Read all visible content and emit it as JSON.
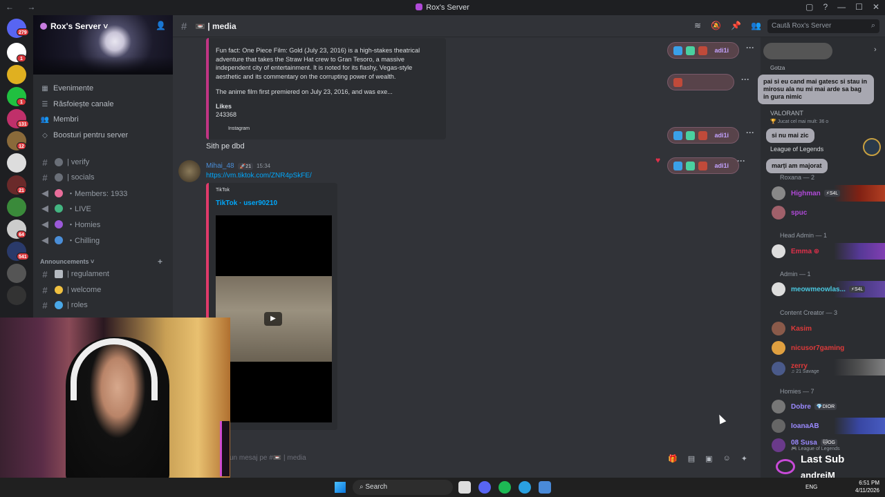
{
  "window": {
    "title": "Rox's Server",
    "nav": "← →",
    "controls": [
      "▢",
      "?",
      "—",
      "☐",
      "✕"
    ]
  },
  "guild_badges": [
    "279",
    "1",
    "1",
    "1",
    "131",
    "12",
    "21",
    "64",
    "541"
  ],
  "server": {
    "name": "Rox's Server ˅"
  },
  "menu": [
    {
      "icon": "calendar-icon",
      "label": "Evenimente"
    },
    {
      "icon": "browse-icon",
      "label": "Răsfoiește canale"
    },
    {
      "icon": "members-icon",
      "label": "Membri"
    },
    {
      "icon": "boost-icon",
      "label": "Boosturi pentru server"
    }
  ],
  "channels": [
    {
      "label": "| verify",
      "color": "#6a6f78"
    },
    {
      "label": "| socials",
      "color": "#6a6f78"
    },
    {
      "label": "・Members: 1933",
      "color": "#e86d9a"
    },
    {
      "label": "・LIVE",
      "color": "#43b581"
    },
    {
      "label": "・Homies",
      "color": "#9b59d8"
    },
    {
      "label": "・Chilling",
      "color": "#4a8ed8"
    }
  ],
  "category": "Announcements ˅",
  "announcement_channels": [
    {
      "label": "| regulament"
    },
    {
      "label": "| welcome"
    },
    {
      "label": "| roles"
    }
  ],
  "header": {
    "channel": "📼 | media",
    "search_placeholder": "Caută Rox's Server"
  },
  "embed": {
    "text": "Fun fact: One Piece Film: Gold (July 23, 2016) is a high-stakes theatrical adventure that takes the Straw Hat crew to Gran Tesoro, a massive independent city of entertainment. It is noted for its flashy, Vegas-style aesthetic and its commentary on the corrupting power of wealth.",
    "text2": "The anime film first premiered on July 23, 2016, and was exe...",
    "likes_label": "Likes",
    "likes": "243368",
    "provider": "Instagram"
  },
  "msg1": "Sith pe dbd",
  "msg2": {
    "author": "Mihai_48",
    "tag": "🚀21",
    "time": "15:34",
    "link": "https://vm.tiktok.com/ZNR4pSkFE/"
  },
  "tiktok": {
    "provider": "TikTok",
    "title": "TikTok · user90210",
    "play": "▶"
  },
  "reactions": [
    "adi1i",
    "adi1i",
    "adi1i",
    "adi1i"
  ],
  "input": {
    "placeholder": "un mesaj pe #📼 | media"
  },
  "members": {
    "cats": [
      "Roxana — 2",
      "Head Admin — 1",
      "Admin — 1",
      "Content Creator — 3",
      "Homies — 7"
    ],
    "roxana": [
      {
        "name": "Highman",
        "tag": "⚡S4L",
        "color": "#b04ad8"
      },
      {
        "name": "spuc",
        "color": "#b04ad8"
      }
    ],
    "headadmin": [
      {
        "name": "Emma ⊕",
        "color": "#e0304a"
      }
    ],
    "admin": [
      {
        "name": "meowmeowlas...",
        "tag": "⚡S4L",
        "color": "#4ac8e0"
      }
    ],
    "cc": [
      {
        "name": "Kasim",
        "color": "#e03a3a"
      },
      {
        "name": "nicusor7gaming",
        "color": "#e03a3a"
      },
      {
        "name": "zerry",
        "sub": "♫ 21 Savage",
        "color": "#e03a3a"
      }
    ],
    "homies": [
      {
        "name": "Dobre",
        "tag": "💎DIOR",
        "color": "#9b8aff"
      },
      {
        "name": "IoanaAB",
        "color": "#9b8aff"
      },
      {
        "name": "08 Susa",
        "tag": "🐱OG",
        "sub": "🎮 League of Legends",
        "color": "#9b8aff"
      }
    ]
  },
  "activity": {
    "game1": "VALORANT",
    "game1sub": "🏆 Jucat cel mai mult: 36 o",
    "game2": "League of Legends",
    "user": "Gotza"
  },
  "bubbles": [
    "pai si eu cand mai gatesc si stau in mirosu ala nu mi mai arde sa bag in gura nimic",
    "si nu mai zic",
    "marți am majorat"
  ],
  "overlay": {
    "line1": "Last Sub",
    "line2": "andreiM"
  },
  "taskbar": {
    "search": "Search",
    "lang": "ENG",
    "time": "6:51 PM",
    "date": "4/11/2026"
  }
}
